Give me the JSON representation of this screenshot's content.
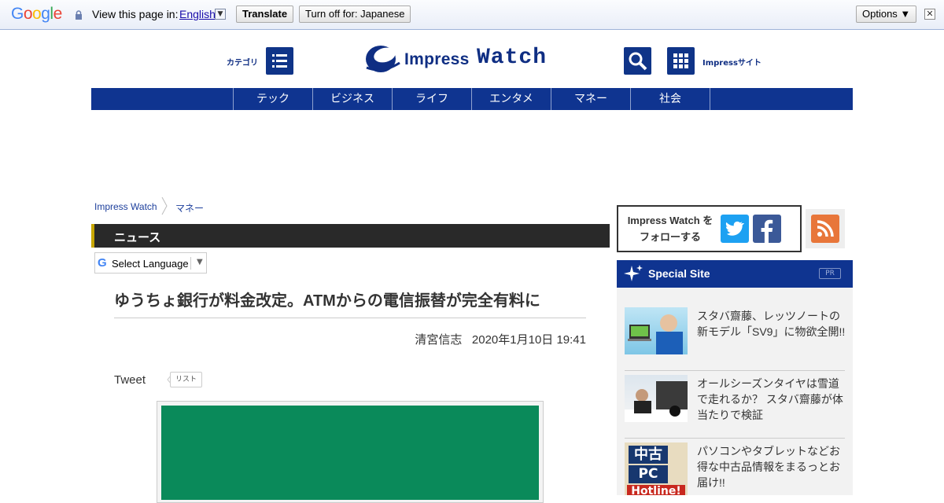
{
  "translate_bar": {
    "brand": "Google",
    "prompt": "View this page in:",
    "language": "English",
    "translate_label": "Translate",
    "turn_off_label": "Turn off for: Japanese",
    "options_label": "Options ▼",
    "close_glyph": "✕",
    "dropdown_glyph": "▼"
  },
  "header": {
    "category_label": "カテゴリ",
    "logo_word1": "Impress",
    "logo_word2": "Watch",
    "sites_label": "Impressサイト"
  },
  "nav": {
    "items": [
      "テック",
      "ビジネス",
      "ライフ",
      "エンタメ",
      "マネー",
      "社会"
    ]
  },
  "breadcrumb": [
    "Impress Watch",
    "マネー"
  ],
  "section": {
    "title": "ニュース"
  },
  "language_selector": {
    "label": "Select Language",
    "arrow": "▼"
  },
  "article": {
    "title": "ゆうちょ銀行が料金改定。ATMからの電信振替が完全有料に",
    "author": "清宮信志",
    "datetime": "2020年1月10日 19:41",
    "tweet_label": "Tweet",
    "list_label": "リスト"
  },
  "sidebar": {
    "follow_line1": "Impress Watch を",
    "follow_line2": "フォローする",
    "special_title": "Special Site",
    "pr_label": "PR",
    "items": [
      {
        "text": "スタバ齋藤、レッツノートの新モデル「SV9」に物欲全開!!"
      },
      {
        "text": "オールシーズンタイヤは雪道で走れるか？ スタバ齋藤が体当たりで検証"
      },
      {
        "text": "パソコンやタブレットなどお得な中古品情報をまるっとお届け!!"
      }
    ],
    "thumb3_line1": "中古",
    "thumb3_line2": "PC",
    "thumb3_line3": "Hotline!"
  },
  "colors": {
    "brand_blue": "#0f3490",
    "dark_bar": "#292929",
    "twitter": "#1da1f2",
    "facebook": "#3b5998",
    "rss": "#e8763a"
  }
}
